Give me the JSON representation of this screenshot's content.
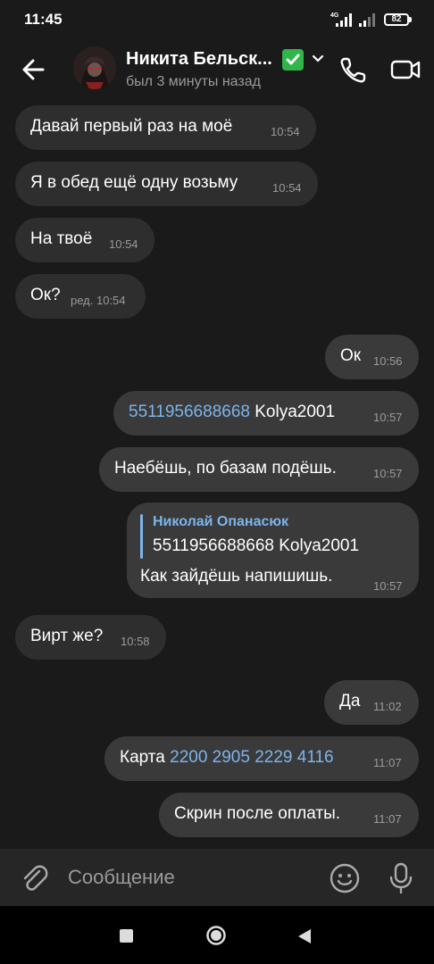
{
  "status_bar": {
    "time": "11:45",
    "network": "4G",
    "battery": "82"
  },
  "header": {
    "contact_name": "Никита Бельск...",
    "last_seen": "был 3 минуты назад"
  },
  "messages": [
    {
      "dir": "in",
      "text": "Давай первый раз на моё",
      "time": "10:54"
    },
    {
      "dir": "in",
      "text": "Я в обед ещё одну возьму",
      "time": "10:54"
    },
    {
      "dir": "in",
      "text": "На твоё",
      "time": "10:54"
    },
    {
      "dir": "in",
      "text": "Ок?",
      "time": "ред. 10:54"
    },
    {
      "dir": "out",
      "text": "Ок",
      "time": "10:56"
    },
    {
      "dir": "out",
      "link": "5511956688668",
      "text": "Kolya2001",
      "time": "10:57"
    },
    {
      "dir": "out",
      "text": "Наебёшь, по базам подёшь.",
      "time": "10:57"
    },
    {
      "dir": "out",
      "reply_author": "Николай Опанасюк",
      "reply_text": "5511956688668 Kolya2001",
      "text": "Как зайдёшь напишишь.",
      "time": "10:57"
    },
    {
      "dir": "in",
      "text": "Вирт же?",
      "time": "10:58"
    },
    {
      "dir": "out",
      "text": "Да",
      "time": "11:02"
    },
    {
      "dir": "out",
      "prefix": "Карта",
      "link": "2200 2905 2229 4116",
      "time": "11:07"
    },
    {
      "dir": "out",
      "text": "Скрин после оплаты.",
      "time": "11:07"
    }
  ],
  "composer": {
    "placeholder": "Сообщение"
  },
  "colors": {
    "background": "#1a1a1a",
    "incoming_bubble": "#2e2e2e",
    "outgoing_bubble": "#3a3a3a",
    "link": "#7cb4ec",
    "verified": "#2fb54a"
  }
}
